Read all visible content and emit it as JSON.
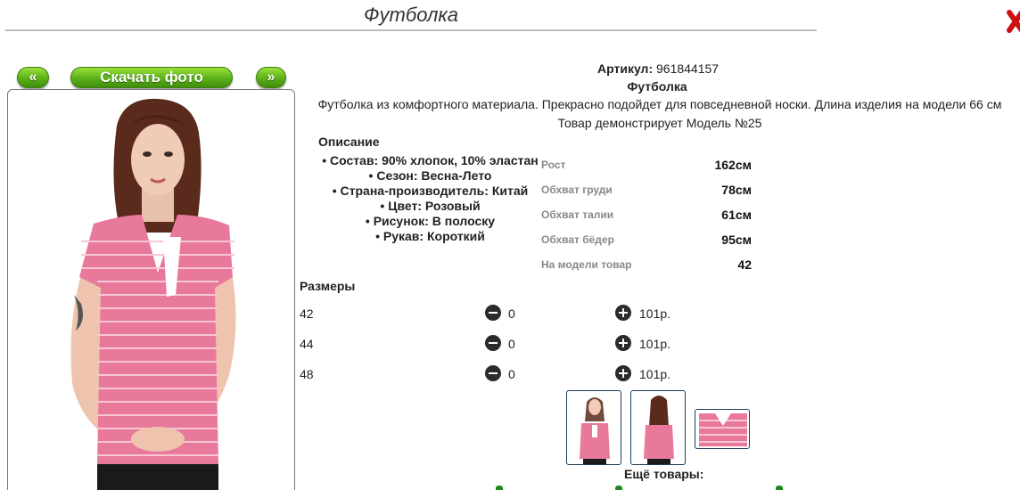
{
  "page": {
    "title": "Футболка"
  },
  "gallery": {
    "prev_label": "«",
    "download_label": "Скачать фото",
    "next_label": "»"
  },
  "product": {
    "sku_label": "Артикул:",
    "sku_value": "961844157",
    "name": "Футболка",
    "description": "Футболка из комфортного материала. Прекрасно подойдет для повседневной носки. Длина изделия на модели 66 см",
    "model_note": "Товар демонстрирует Модель №25"
  },
  "description_section": {
    "heading": "Описание",
    "attributes": [
      "Состав: 90% хлопок, 10% эластан",
      "Сезон: Весна-Лето",
      "Страна-производитель: Китай",
      "Цвет: Розовый",
      "Рисунок: В полоску",
      "Рукав: Короткий"
    ]
  },
  "measurements": [
    {
      "label": "Рост",
      "value": "162см"
    },
    {
      "label": "Обхват груди",
      "value": "78см"
    },
    {
      "label": "Обхват талии",
      "value": "61см"
    },
    {
      "label": "Обхват бёдер",
      "value": "95см"
    },
    {
      "label": "На модели товар",
      "value": "42"
    }
  ],
  "sizes": {
    "heading": "Размеры",
    "rows": [
      {
        "size": "42",
        "qty": "0",
        "price": "101р."
      },
      {
        "size": "44",
        "qty": "0",
        "price": "101р."
      },
      {
        "size": "48",
        "qty": "0",
        "price": "101р."
      }
    ]
  },
  "more_products": {
    "heading": "Ещё товары:"
  },
  "colors": {
    "accent_green": "#5fb31a",
    "shirt_pink": "#e9799a",
    "close_red": "#cc1111"
  }
}
